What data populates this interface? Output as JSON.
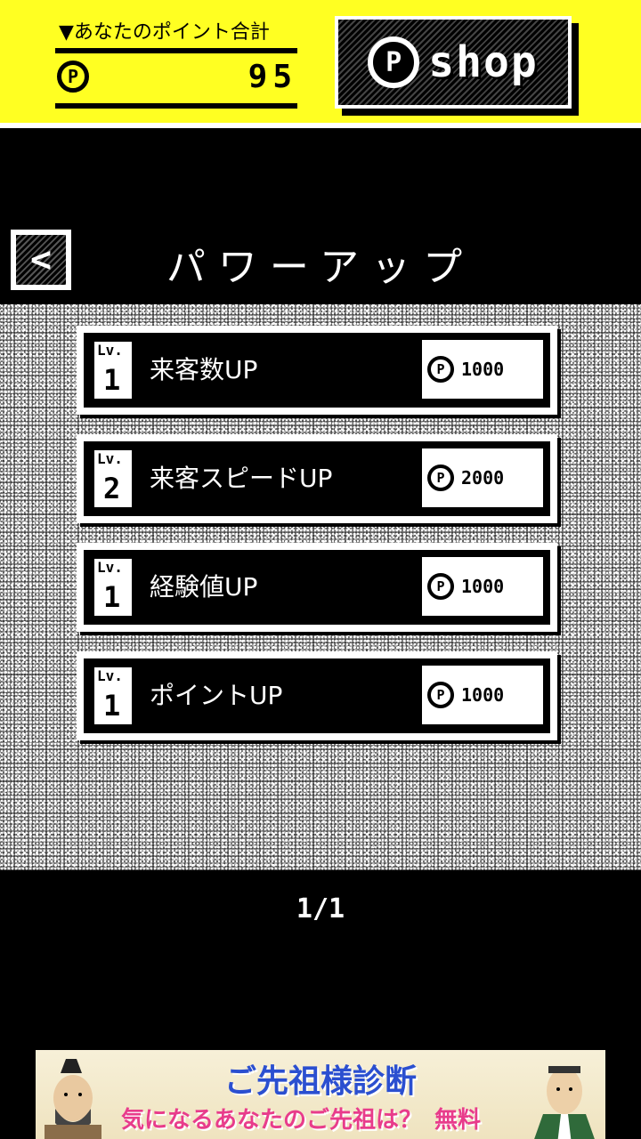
{
  "points": {
    "label": "▼あなたのポイント合計",
    "coin_symbol": "P",
    "value": "95"
  },
  "shop": {
    "coin_symbol": "P",
    "label": "shop"
  },
  "header": {
    "back_symbol": "<",
    "title": "パワーアップ"
  },
  "upgrades": [
    {
      "lv_label": "Lv.",
      "level": "1",
      "name": "来客数UP",
      "coin_symbol": "P",
      "price": "1000"
    },
    {
      "lv_label": "Lv.",
      "level": "2",
      "name": "来客スピードUP",
      "coin_symbol": "P",
      "price": "2000"
    },
    {
      "lv_label": "Lv.",
      "level": "1",
      "name": "経験値UP",
      "coin_symbol": "P",
      "price": "1000"
    },
    {
      "lv_label": "Lv.",
      "level": "1",
      "name": "ポイントUP",
      "coin_symbol": "P",
      "price": "1000"
    }
  ],
  "pager": {
    "text": "1/1"
  },
  "ad": {
    "title": "ご先祖様診断",
    "subtitle": "気になるあなたのご先祖は？",
    "badge": "無料"
  },
  "colors": {
    "accent_yellow": "#ffff22",
    "ad_title_blue": "#2b4fd0",
    "ad_sub_pink": "#e83c8b"
  }
}
